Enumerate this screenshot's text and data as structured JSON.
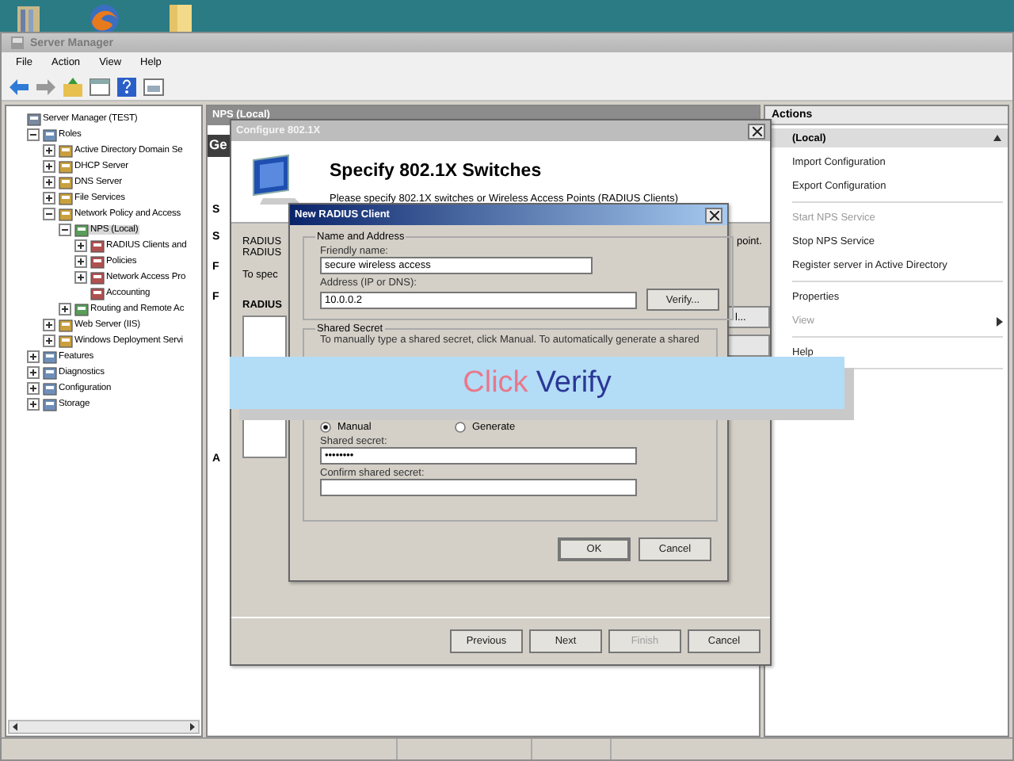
{
  "window": {
    "title": "Server Manager"
  },
  "menu": [
    "File",
    "Action",
    "View",
    "Help"
  ],
  "tree": [
    {
      "label": "Server Manager (TEST)",
      "selected": false,
      "children": [
        {
          "label": "Roles",
          "expanded": true,
          "selected": false,
          "children": [
            {
              "label": "Active Directory Domain Se",
              "expanded": false,
              "selected": false
            },
            {
              "label": "DHCP Server",
              "expanded": false,
              "selected": false
            },
            {
              "label": "DNS Server",
              "expanded": false,
              "selected": false
            },
            {
              "label": "File Services",
              "expanded": false,
              "selected": false
            },
            {
              "label": "Network Policy and Access",
              "expanded": true,
              "selected": false,
              "children": [
                {
                  "label": "NPS (Local)",
                  "expanded": true,
                  "selected": true,
                  "children": [
                    {
                      "label": "RADIUS Clients and",
                      "expanded": false,
                      "selected": false
                    },
                    {
                      "label": "Policies",
                      "expanded": false,
                      "selected": false
                    },
                    {
                      "label": "Network Access Pro",
                      "expanded": false,
                      "selected": false
                    },
                    {
                      "label": "Accounting",
                      "selected": false
                    }
                  ]
                },
                {
                  "label": "Routing and Remote Ac",
                  "expanded": false,
                  "selected": false
                }
              ]
            },
            {
              "label": "Web Server (IIS)",
              "expanded": false,
              "selected": false
            },
            {
              "label": "Windows Deployment Servi",
              "expanded": false,
              "selected": false
            }
          ]
        },
        {
          "label": "Features",
          "expanded": false,
          "selected": false
        },
        {
          "label": "Diagnostics",
          "expanded": false,
          "selected": false
        },
        {
          "label": "Configuration",
          "expanded": false,
          "selected": false
        },
        {
          "label": "Storage",
          "expanded": false,
          "selected": false
        }
      ]
    }
  ],
  "nps_pane": {
    "title": "NPS (Local)",
    "header": "Ge",
    "fragments": [
      "S",
      "S",
      "F",
      "F"
    ],
    "footer": "A"
  },
  "actions": {
    "title": "Actions",
    "section": "(Local)",
    "expanded": true,
    "groups": [
      [
        {
          "label": "Import Configuration",
          "disabled": false,
          "submenu": false
        },
        {
          "label": "Export Configuration",
          "disabled": false,
          "submenu": false
        }
      ],
      [
        {
          "label": "Start NPS Service",
          "disabled": true,
          "submenu": false
        },
        {
          "label": "Stop NPS Service",
          "disabled": false,
          "submenu": false
        },
        {
          "label": "Register server in Active Directory",
          "disabled": false,
          "submenu": false
        }
      ],
      [
        {
          "label": "Properties",
          "disabled": false,
          "submenu": false
        },
        {
          "label": "View",
          "disabled": true,
          "submenu": true
        }
      ],
      [
        {
          "label": "Help",
          "disabled": false,
          "submenu": false
        }
      ]
    ]
  },
  "configure_dialog": {
    "title": "Configure 802.1X",
    "heading": "Specify 802.1X Switches",
    "subtitle": "Please specify 802.1X switches or Wireless Access Points (RADIUS Clients)",
    "intro": [
      "RADIUS",
      "RADIUS"
    ],
    "hint": "To spec",
    "list_label": "RADIUS",
    "side_text": "point.",
    "side_button": "l...",
    "buttons": [
      {
        "label": "Previous",
        "disabled": false
      },
      {
        "label": "Next",
        "disabled": false
      },
      {
        "label": "Finish",
        "disabled": true
      },
      {
        "label": "Cancel",
        "disabled": false
      }
    ]
  },
  "radius_dialog": {
    "title": "New RADIUS Client",
    "name_group": {
      "title": "Name and Address",
      "friendly_label": "Friendly name:",
      "friendly_value": "secure wireless access",
      "address_label": "Address (IP or DNS):",
      "address_value": "10.0.0.2",
      "verify": "Verify..."
    },
    "secret_group": {
      "title": "Shared Secret",
      "description": "To manually type a shared secret, click Manual. To automatically generate a shared",
      "options": [
        {
          "label": "Manual",
          "selected": true
        },
        {
          "label": "Generate",
          "selected": false
        }
      ],
      "secret_label": "Shared secret:",
      "secret_value": "••••••••",
      "confirm_label": "Confirm shared secret:"
    },
    "buttons": [
      {
        "label": "OK",
        "default": true
      },
      {
        "label": "Cancel",
        "default": false
      }
    ]
  },
  "overlay": {
    "parts": [
      {
        "text": "Click",
        "color": "#e8788a"
      },
      {
        "text": "Verify",
        "color": "#2b3796"
      }
    ]
  }
}
